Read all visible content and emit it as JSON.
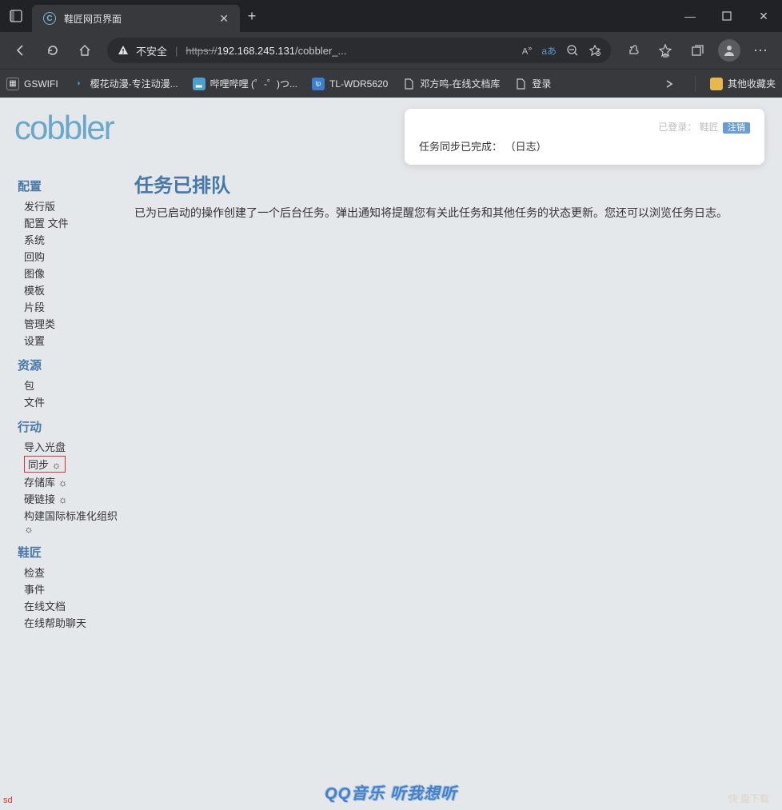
{
  "browser": {
    "tab_title": "鞋匠网页界面",
    "new_tab": "+",
    "win_min": "—",
    "win_max": "□",
    "win_close": "✕",
    "back": "←",
    "forward": "→",
    "refresh": "⟳",
    "home": "⌂",
    "addr_warn": "不安全",
    "addr_scheme": "https",
    "addr_host": "192.168.245.131",
    "addr_path": "/cobbler_...",
    "translate_label": "aあ",
    "bookmarks": [
      {
        "icon": "▦",
        "color": "#e1e2e4",
        "label": "GSWIFI"
      },
      {
        "icon": "◐",
        "color": "#4aa0d0",
        "label": "樱花动漫-专注动漫..."
      },
      {
        "icon": "▂",
        "color": "#4aa0d0",
        "label": "哔哩哔哩 (゜-゜)つ..."
      },
      {
        "icon": "tp",
        "color": "#3a80d0",
        "label": "TL-WDR5620"
      },
      {
        "icon": "🗎",
        "color": "#e1e2e4",
        "label": "邓方鸣-在线文档库"
      },
      {
        "icon": "🗎",
        "color": "#e1e2e4",
        "label": "登录"
      }
    ],
    "other_bookmarks": "其他收藏夹"
  },
  "notif": {
    "login_prefix": "已登录：",
    "login_user": "鞋匠",
    "logout": "注销",
    "task_done": "任务同步已完成：",
    "task_log": "（日志）"
  },
  "logo": "cobbler",
  "sidebar": {
    "sections": [
      {
        "head": "配置",
        "items": [
          "发行版",
          "配置 文件",
          "系统",
          "回购",
          "图像",
          "模板",
          "片段",
          "管理类",
          "设置"
        ]
      },
      {
        "head": "资源",
        "items": [
          "包",
          "文件"
        ]
      },
      {
        "head": "行动",
        "items_gear": [
          "导入光盘",
          "同步 ☼",
          "存储库 ☼",
          "硬链接 ☼",
          "构建国际标准化组织 ☼"
        ],
        "highlight_index": 1
      },
      {
        "head": "鞋匠",
        "items": [
          "检查",
          "事件",
          "在线文档",
          "在线帮助聊天"
        ]
      }
    ]
  },
  "main": {
    "heading": "任务已排队",
    "body": "已为已启动的操作创建了一个后台任务。弹出通知将提醒您有关此任务和其他任务的状态更新。您还可以浏览任务日志。"
  },
  "watermark": "QQ音乐 听我想听",
  "corner": "快 盘下载",
  "sd": "sd"
}
